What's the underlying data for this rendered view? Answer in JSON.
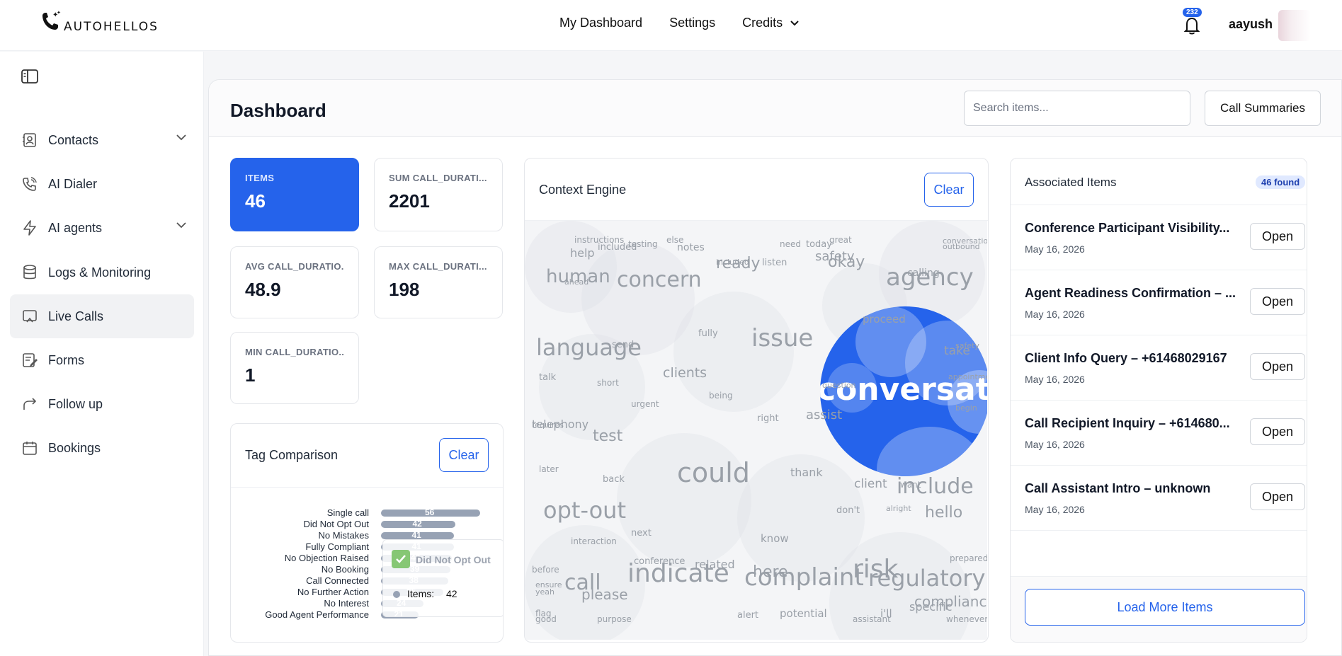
{
  "brand": {
    "name": "AUTOHELLOS"
  },
  "topnav": {
    "dashboard": "My Dashboard",
    "settings": "Settings",
    "credits": "Credits"
  },
  "user": {
    "name": "aayush",
    "notifications": "232"
  },
  "sidebar": {
    "items": [
      {
        "label": "Contacts",
        "icon": "contacts-icon"
      },
      {
        "label": "AI Dialer",
        "icon": "phone-icon"
      },
      {
        "label": "AI agents",
        "icon": "lightning-icon"
      },
      {
        "label": "Logs & Monitoring",
        "icon": "database-icon"
      },
      {
        "label": "Live Calls",
        "icon": "cast-icon"
      },
      {
        "label": "Forms",
        "icon": "form-icon"
      },
      {
        "label": "Follow up",
        "icon": "redo-icon"
      },
      {
        "label": "Bookings",
        "icon": "calendar-icon"
      }
    ],
    "active": "Live Calls"
  },
  "header": {
    "title": "Dashboard",
    "search_placeholder": "Search items...",
    "summaries_button": "Call Summaries"
  },
  "stats": [
    {
      "label": "ITEMS",
      "value": "46"
    },
    {
      "label": "SUM CALL_DURATI...",
      "value": "2201"
    },
    {
      "label": "AVG CALL_DURATIO...",
      "value": "48.9"
    },
    {
      "label": "MAX CALL_DURATI...",
      "value": "198"
    },
    {
      "label": "MIN CALL_DURATIO...",
      "value": "1"
    }
  ],
  "tag_comparison": {
    "title": "Tag Comparison",
    "clear": "Clear",
    "tooltip": {
      "label": "Did Not Opt Out",
      "metric": "Items:",
      "value": "42"
    }
  },
  "chart_data": {
    "type": "bar",
    "orientation": "horizontal",
    "categories": [
      "Single call",
      "Did Not Opt Out",
      "No Mistakes",
      "Fully Compliant",
      "No Objection Raised",
      "No Booking",
      "Call Connected",
      "No Further Action",
      "No Interest",
      "Good Agent Performance"
    ],
    "values": [
      56,
      42,
      41,
      41,
      40,
      39,
      38,
      35,
      24,
      21
    ],
    "xlim": [
      0,
      60
    ]
  },
  "context_engine": {
    "title": "Context Engine",
    "clear": "Clear",
    "highlight": "conversation"
  },
  "associated": {
    "title": "Associated Items",
    "badge": "46 found",
    "open_label": "Open",
    "items": [
      {
        "title": "Conference Participant Visibility...",
        "date": "May 16, 2026"
      },
      {
        "title": "Agent Readiness Confirmation – ...",
        "date": "May 16, 2026"
      },
      {
        "title": "Client Info Query – +61468029167",
        "date": "May 16, 2026"
      },
      {
        "title": "Call Recipient Inquiry – +614680...",
        "date": "May 16, 2026"
      },
      {
        "title": "Call Assistant Intro – unknown",
        "date": "May 16, 2026"
      }
    ],
    "load_more": "Load More Items"
  },
  "colors": {
    "accent": "#2563eb",
    "bar": "#97a2b4"
  }
}
